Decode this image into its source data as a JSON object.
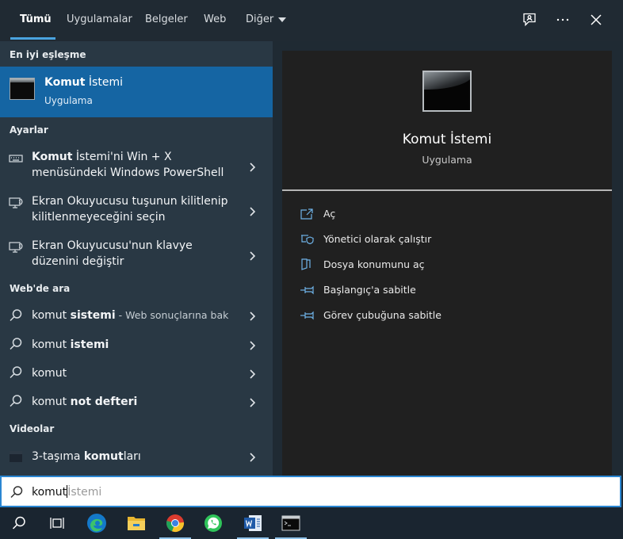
{
  "tabs": [
    {
      "label": "Tümü",
      "active": true
    },
    {
      "label": "Uygulamalar"
    },
    {
      "label": "Belgeler"
    },
    {
      "label": "Web"
    },
    {
      "label": "Diğer"
    }
  ],
  "top_icons": [
    "feedback-icon",
    "more-options-icon",
    "close-icon"
  ],
  "left": {
    "best_match_title": "En iyi eşleşme",
    "best_match": {
      "name_bold": "Komut",
      "name_rest": " İstemi",
      "type": "Uygulama",
      "icon": "command-prompt-icon"
    },
    "settings_title": "Ayarlar",
    "settings": [
      {
        "icon": "keyboard-icon",
        "line1_bold": "Komut",
        "line1_rest": " İstemi'ni Win + X",
        "line2": "menüsündeki Windows PowerShell"
      },
      {
        "icon": "narrator-icon",
        "line1_bold": "",
        "line1_rest": "Ekran Okuyucusu tuşunun kilitlenip",
        "line2": "kilitlenmeyeceğini seçin"
      },
      {
        "icon": "narrator-icon",
        "line1_bold": "",
        "line1_rest": "Ekran Okuyucusu'nun klavye",
        "line2": "düzenini değiştir"
      }
    ],
    "web_title": "Web'de ara",
    "web": [
      {
        "prefix": "komut ",
        "bold": "sistemi",
        "suffix": " - Web sonuçlarına bak"
      },
      {
        "prefix": "komut ",
        "bold": "istemi",
        "suffix": ""
      },
      {
        "prefix": "komut",
        "bold": "",
        "suffix": ""
      },
      {
        "prefix": "komut ",
        "bold": "not defteri",
        "suffix": ""
      }
    ],
    "videos_title": "Videolar",
    "videos": [
      {
        "prefix": "3-taşıma ",
        "bold": "komut",
        "rest": "ları"
      }
    ]
  },
  "right": {
    "title": "Komut İstemi",
    "subtitle": "Uygulama",
    "actions": [
      {
        "label": "Aç",
        "icon": "open-icon"
      },
      {
        "label": "Yönetici olarak çalıştır",
        "icon": "shield-icon"
      },
      {
        "label": "Dosya konumunu aç",
        "icon": "file-location-icon"
      },
      {
        "label": "Başlangıç'a sabitle",
        "icon": "pin-icon"
      },
      {
        "label": "Görev çubuğuna sabitle",
        "icon": "pin-icon"
      }
    ]
  },
  "search": {
    "typed": "komut",
    "suggestion": "İstemi"
  },
  "taskbar": [
    "search-icon",
    "task-view-icon",
    "edge-icon",
    "file-explorer-icon",
    "chrome-icon",
    "whatsapp-icon",
    "word-icon",
    "command-prompt-icon"
  ],
  "colors": {
    "accent": "#1565a3",
    "left_bg": "#293844",
    "right_bg": "#202020",
    "action_icon": "#6fb3e8"
  }
}
